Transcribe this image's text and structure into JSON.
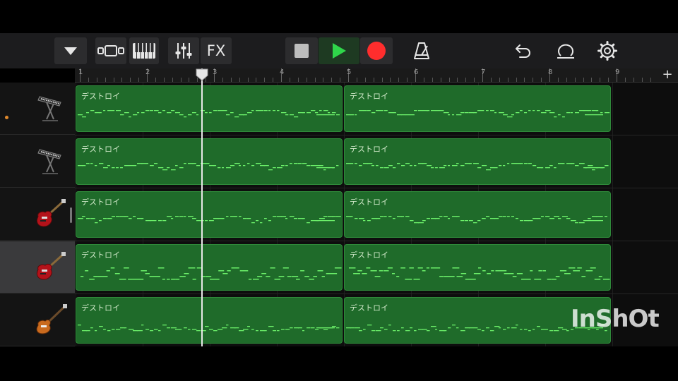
{
  "toolbar": {
    "fx_label": "FX",
    "buttons": [
      "tracks-dropdown",
      "view-toggle",
      "instrument-keyboard",
      "mixer",
      "fx",
      "stop",
      "play",
      "record",
      "metronome",
      "undo",
      "loop-browser",
      "settings"
    ]
  },
  "ruler": {
    "bars": [
      "1",
      "2",
      "3",
      "4",
      "5",
      "6",
      "7",
      "8",
      "9"
    ]
  },
  "tracks": [
    {
      "instrument": "keyboard-icon",
      "regions": [
        "デストロイ",
        "デストロイ"
      ],
      "selected": false,
      "record_dot": true
    },
    {
      "instrument": "keyboard-icon",
      "regions": [
        "デストロイ",
        "デストロイ"
      ],
      "selected": false,
      "record_dot": false
    },
    {
      "instrument": "electric-guitar-icon",
      "regions": [
        "デストロイ",
        "デストロイ"
      ],
      "selected": false,
      "record_dot": false
    },
    {
      "instrument": "electric-guitar-icon",
      "regions": [
        "デストロイ",
        "デストロイ"
      ],
      "selected": true,
      "record_dot": false
    },
    {
      "instrument": "bass-guitar-icon",
      "regions": [
        "デストロイ",
        "デストロイ"
      ],
      "selected": false,
      "record_dot": false
    }
  ],
  "playhead_bar_position": 2.9,
  "watermark": "InShOt",
  "colors": {
    "region_fill": "#1f6b2a",
    "note_color": "#6cf06a",
    "play_green": "#2fd64a",
    "record_red": "#ff2d2d",
    "record_dot": "#e0892c"
  }
}
